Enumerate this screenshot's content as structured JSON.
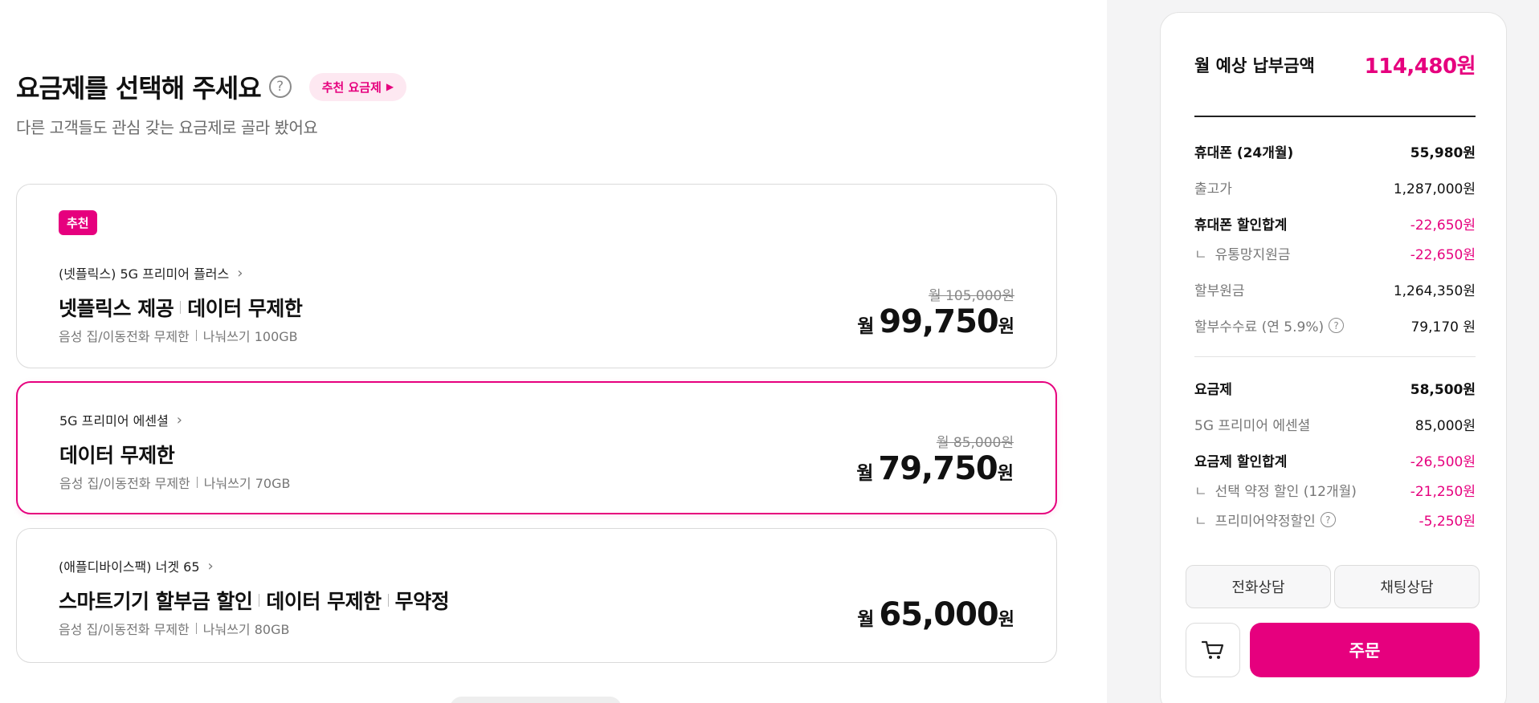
{
  "header": {
    "title": "요금제를 선택해 주세요",
    "help": "?",
    "recommend_chip": "추천 요금제",
    "recommend_chip_arrow": "▶",
    "subtitle": "다른 고객들도 관심 갖는 요금제로 골라 봤어요"
  },
  "plans": [
    {
      "badge": "추천",
      "name": "(넷플릭스) 5G 프리미어 플러스",
      "headline": [
        "넷플릭스 제공",
        "데이터 무제한"
      ],
      "desc": [
        "음성 집/이동전화 무제한",
        "나눠쓰기 100GB"
      ],
      "original_price": "월 105,000원",
      "price_prefix": "월",
      "price": "99,750",
      "price_suffix": "원",
      "selected": false
    },
    {
      "name": "5G 프리미어 에센셜",
      "headline": [
        "데이터 무제한"
      ],
      "desc": [
        "음성 집/이동전화 무제한",
        "나눠쓰기 70GB"
      ],
      "original_price": "월 85,000원",
      "price_prefix": "월",
      "price": "79,750",
      "price_suffix": "원",
      "selected": true
    },
    {
      "name": "(애플디바이스팩) 너겟 65",
      "headline": [
        "스마트기기 할부금 할인",
        "데이터 무제한",
        "무약정"
      ],
      "desc": [
        "음성 집/이동전화 무제한",
        "나눠쓰기 80GB"
      ],
      "price_prefix": "월",
      "price": "65,000",
      "price_suffix": "원",
      "selected": false
    }
  ],
  "summary": {
    "label": "월 예상 납부금액",
    "total": "114,480원",
    "phone": {
      "label": "휴대폰 (24개월)",
      "value": "55,980원"
    },
    "release_price": {
      "label": "출고가",
      "value": "1,287,000원"
    },
    "phone_discount": {
      "label": "휴대폰 할인합계",
      "value": "-22,650원"
    },
    "distribution_subsidy": {
      "label": "유통망지원금",
      "value": "-22,650원"
    },
    "installment_principal": {
      "label": "할부원금",
      "value": "1,264,350원"
    },
    "installment_fee": {
      "label": "할부수수료 (연 5.9%)",
      "value": "79,170 원"
    },
    "plan": {
      "label": "요금제",
      "value": "58,500원"
    },
    "plan_name": {
      "label": "5G 프리미어 에센셜",
      "value": "85,000원"
    },
    "plan_discount": {
      "label": "요금제 할인합계",
      "value": "-26,500원"
    },
    "contract_discount": {
      "label": "선택 약정 할인 (12개월)",
      "value": "-21,250원"
    },
    "premier_discount": {
      "label": "프리미어약정할인",
      "value": "-5,250원"
    },
    "corner_mark": "ㄴ"
  },
  "actions": {
    "phone_consult": "전화상담",
    "chat_consult": "채팅상담",
    "order": "주문"
  },
  "colors": {
    "accent": "#e6007e",
    "accent_soft": "#fde8f1"
  },
  "icons": {
    "help": "question-circle-icon",
    "cart": "shopping-cart-icon",
    "chevron": "chevron-right-icon"
  }
}
